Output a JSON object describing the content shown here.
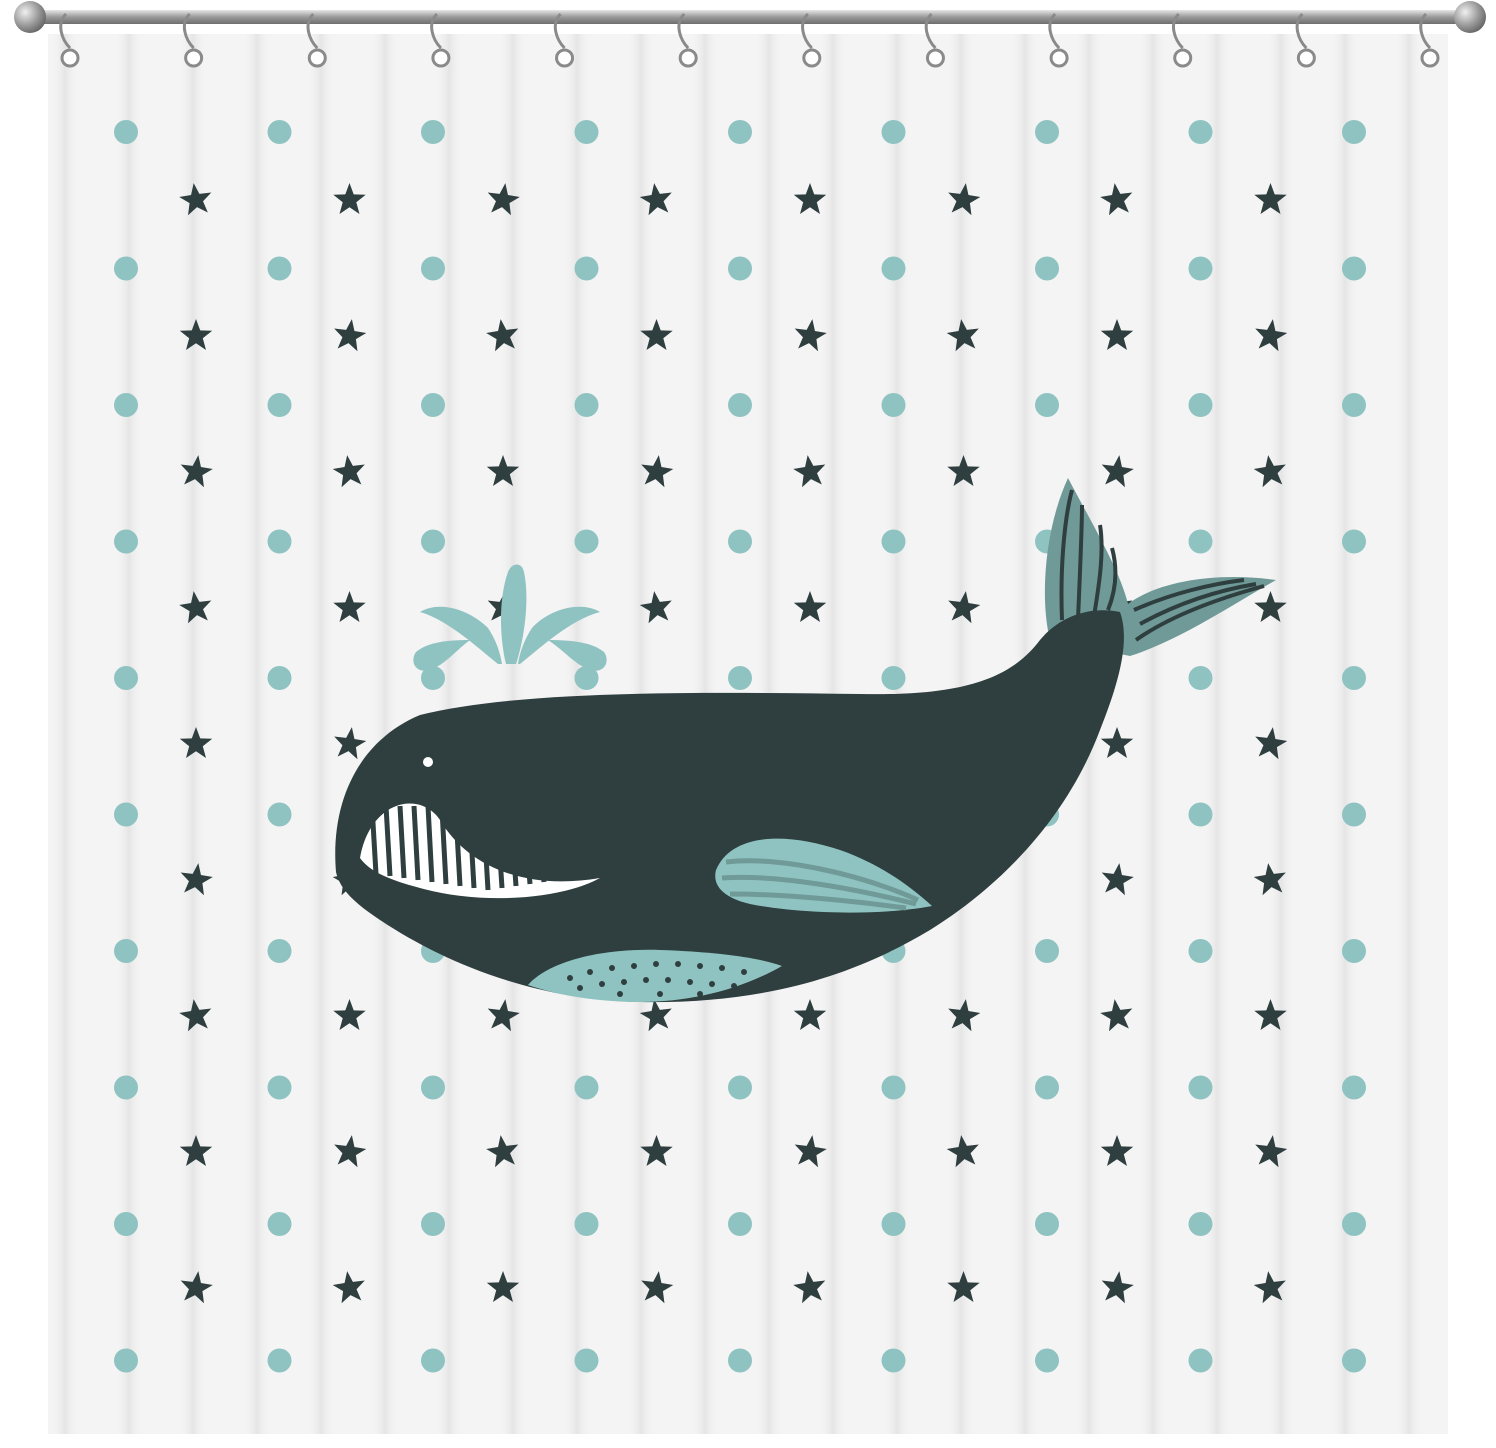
{
  "image": {
    "subject": "whale",
    "colors": {
      "background": "#ffffff",
      "curtain_base": "#f3f3f3",
      "fold_shadow": "#dcdcdc",
      "dot": "#8fc3c1",
      "star": "#2f3e3e",
      "whale_body": "#2f3e3e",
      "whale_accent": "#8fc3c1",
      "rod": "#9a9a9a",
      "rod_highlight": "#d8d8d8",
      "ring": "#8a8a8a"
    },
    "pattern": {
      "dot_columns": 9,
      "dot_rows": 10,
      "star_columns": 8,
      "star_rows": 9
    },
    "rings_count": 12
  }
}
